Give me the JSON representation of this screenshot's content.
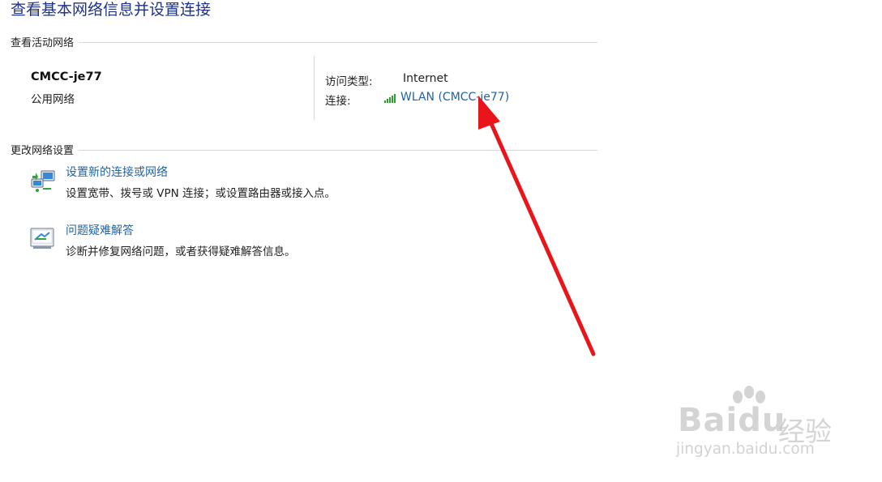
{
  "page": {
    "title": "查看基本网络信息并设置连接"
  },
  "active_networks": {
    "section_label": "查看活动网络",
    "network": {
      "name": "CMCC-je77",
      "type": "公用网络"
    },
    "access_type_label": "访问类型:",
    "access_type_value": "Internet",
    "connection_label": "连接:",
    "connection_value": "WLAN (CMCC-je77)",
    "connection_icon": "wifi-signal-icon"
  },
  "change_settings": {
    "section_label": "更改网络设置",
    "tasks": [
      {
        "link": "设置新的连接或网络",
        "description": "设置宽带、拨号或 VPN 连接；或设置路由器或接入点。",
        "icon": "new-connection-icon"
      },
      {
        "link": "问题疑难解答",
        "description": "诊断并修复网络问题，或者获得疑难解答信息。",
        "icon": "troubleshoot-icon"
      }
    ]
  },
  "annotation": {
    "arrow_color": "#e8161b"
  },
  "watermark": {
    "brand": "Baidu",
    "brand_cn": "经验",
    "url": "jingyan.baidu.com"
  },
  "colors": {
    "link": "#1e64a5",
    "title": "#1e3287",
    "signal": "#2e9d2e"
  }
}
